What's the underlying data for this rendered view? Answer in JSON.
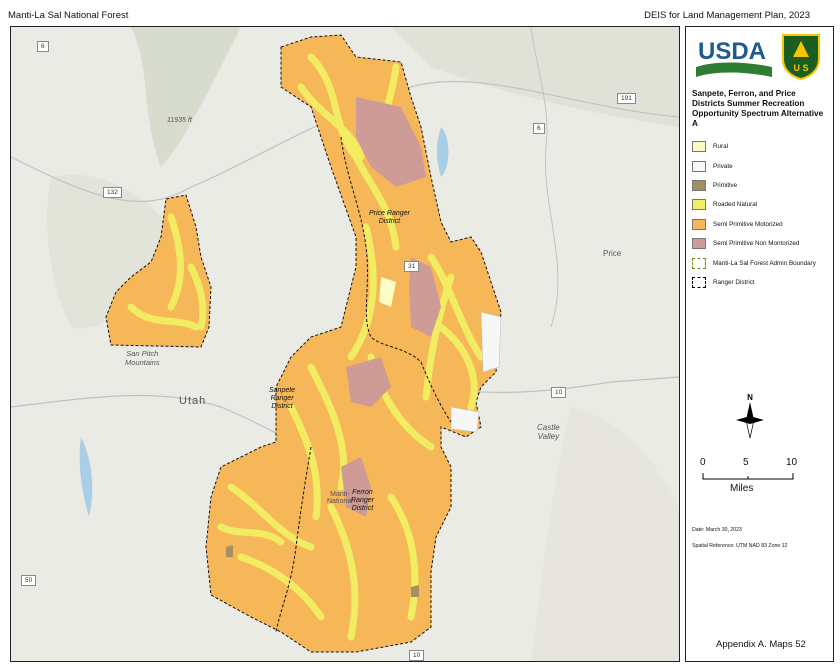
{
  "header": {
    "left_text": "Manti-La Sal National Forest",
    "right_text": "DEIS for Land Management Plan, 2023"
  },
  "map": {
    "place_labels": {
      "utah": "Utah",
      "price": "Price",
      "san_pitch": "San Pitch\nMountains",
      "castle_valley": "Castle\nValley",
      "manti_nf": "Manti-\nNational"
    },
    "elevation_label": "11935 ft",
    "road_shields": [
      "6",
      "191",
      "6",
      "132",
      "31",
      "10",
      "10",
      "50",
      "10"
    ],
    "district_labels": {
      "price": "Price Ranger\nDistrict",
      "sanpete": "Sanpete\nRanger\nDistrict",
      "ferron": "Ferron\nRanger\nDistrict"
    }
  },
  "legend": {
    "title": "Sanpete, Ferron, and Price Districts Summer Recreation Opportunity Spectrum Alternative A",
    "items": [
      {
        "label": "Rural",
        "color": "#fdfcc6"
      },
      {
        "label": "Private",
        "color": "#f7f7f7"
      },
      {
        "label": "Primitive",
        "color": "#a58e62"
      },
      {
        "label": "Roaded Natural",
        "color": "#f1ef62"
      },
      {
        "label": "Semi Primitive Motorized",
        "color": "#f6b758"
      },
      {
        "label": "Semi Primitive Non Montorized",
        "color": "#cf9b96"
      },
      {
        "label": "Manti-La Sal Forest Admin Boundary",
        "color": "#6b8e23"
      },
      {
        "label": "Ranger District",
        "color": "#000000"
      }
    ]
  },
  "north_label": "N",
  "scale": {
    "ticks": [
      "0",
      "5",
      "10"
    ],
    "unit": "Miles"
  },
  "meta": {
    "date": "Date: March 30, 2023",
    "spatial_ref": "Spatial Reference: UTM NAD 83 Zone 12"
  },
  "footer": {
    "appendix": "Appendix A. Maps   52"
  },
  "logos": {
    "usda": "USDA",
    "usfs": "U S"
  }
}
